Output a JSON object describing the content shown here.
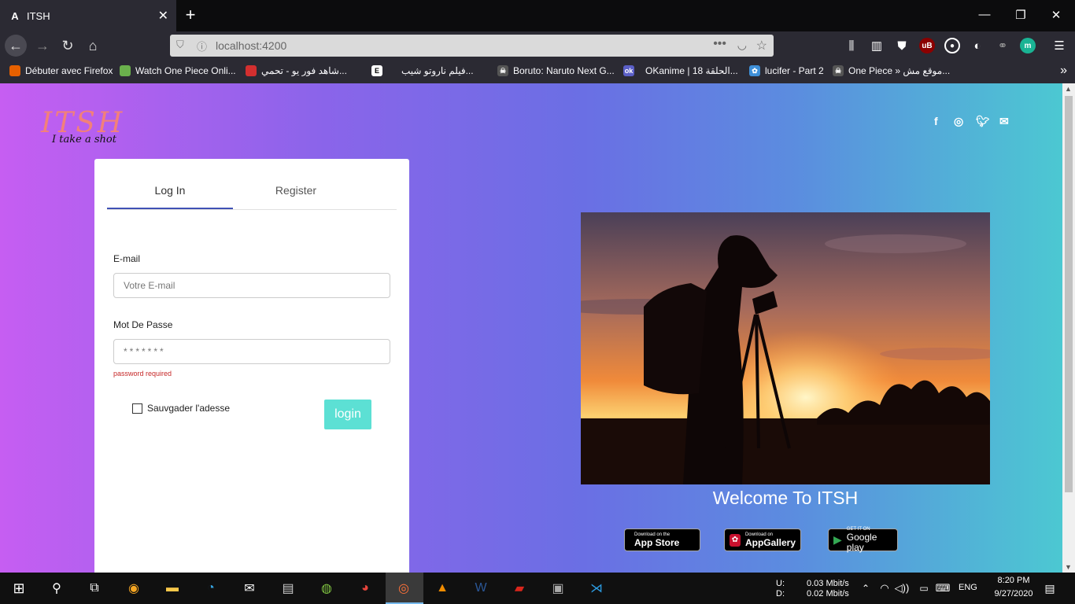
{
  "browser": {
    "tab_title": "ITSH",
    "url": "localhost:4200",
    "bookmarks": [
      "Débuter avec Firefox",
      "Watch One Piece Onli...",
      "شاهد فور يو - تحمي...",
      "فيلم ناروتو شيب...",
      "Boruto: Naruto Next G...",
      "OKanime | الحلقة 18...",
      "lucifer - Part 2",
      "One Piece » موقع مش..."
    ]
  },
  "page": {
    "logo_text": "ITSH",
    "logo_tagline": "I take a shot",
    "social_icons": [
      "facebook-icon",
      "instagram-icon",
      "twitter-icon",
      "email-icon"
    ],
    "tabs": [
      "Log In",
      "Register"
    ],
    "active_tab": "Log In",
    "email_label": "E-mail",
    "email_placeholder": "Votre E-mail",
    "password_label": "Mot De Passe",
    "password_placeholder": "*******",
    "password_error": "password required",
    "remember_label": "Sauvgader l'adesse",
    "login_label": "login",
    "welcome": "Welcome To ITSH",
    "stores": [
      {
        "small": "Download on the",
        "big": "App Store"
      },
      {
        "small": "Download on",
        "big": "AppGallery"
      },
      {
        "small": "GET IT ON",
        "big": "Google play"
      }
    ]
  },
  "taskbar": {
    "upload_label": "U:",
    "download_label": "D:",
    "upload_speed": "0.03 Mbit/s",
    "download_speed": "0.02 Mbit/s",
    "language": "ENG",
    "time": "8:20 PM",
    "date": "9/27/2020"
  },
  "colors": {
    "accent_tab": "#3f51b5",
    "login_button": "#5ce0d4",
    "error": "#c62828",
    "logo": "#f2807a"
  }
}
